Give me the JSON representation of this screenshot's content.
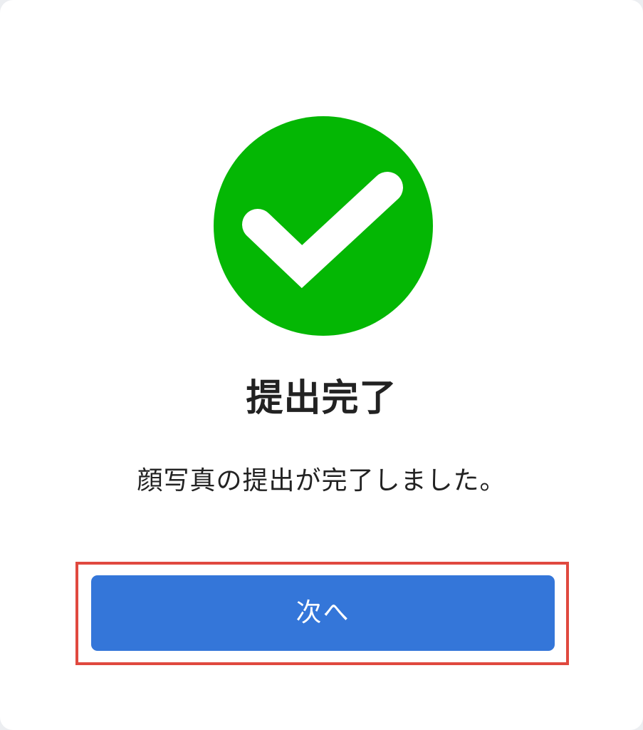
{
  "dialog": {
    "icon": "check-circle-icon",
    "icon_color": "#04b704",
    "title": "提出完了",
    "message": "顔写真の提出が完了しました。",
    "next_button_label": "次へ",
    "button_color": "#3476d9",
    "highlight_color": "#e0493f"
  }
}
